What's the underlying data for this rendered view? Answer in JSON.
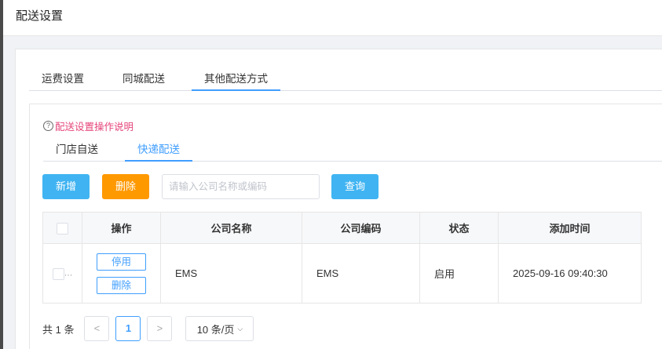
{
  "page": {
    "title": "配送设置"
  },
  "tabs": [
    {
      "label": "运费设置"
    },
    {
      "label": "同城配送"
    },
    {
      "label": "其他配送方式"
    }
  ],
  "help": {
    "icon": "question-circle-icon",
    "text": "配送设置操作说明"
  },
  "sub_tabs": [
    {
      "label": "门店自送"
    },
    {
      "label": "快递配送"
    }
  ],
  "toolbar": {
    "add_label": "新增",
    "delete_label": "删除",
    "search_placeholder": "请输入公司名称或编码",
    "search_value": "",
    "query_label": "查询"
  },
  "table": {
    "columns": [
      "",
      "操作",
      "公司名称",
      "公司编码",
      "状态",
      "添加时间"
    ],
    "rows": [
      {
        "ellipsis": "…",
        "actions": [
          "停用",
          "删除"
        ],
        "company_name": "EMS",
        "company_code": "EMS",
        "status": "启用",
        "added_time": "2025-09-16 09:40:30"
      }
    ]
  },
  "pagination": {
    "total_text": "共 1 条",
    "prev": "<",
    "current_page": "1",
    "next": ">",
    "page_size": "10 条/页"
  },
  "colors": {
    "primary": "#409eff",
    "add_button": "#40b4f2",
    "delete_button": "#ff9900",
    "help_link": "#e6457a"
  }
}
